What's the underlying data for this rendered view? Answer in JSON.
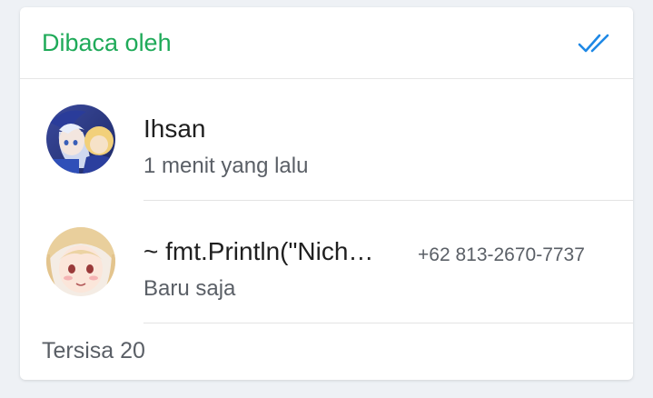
{
  "header": {
    "title": "Dibaca oleh",
    "status_icon": "double-check-icon",
    "title_color": "#1faa59",
    "icon_color": "#1e88e5"
  },
  "readers": [
    {
      "name": "Ihsan",
      "time": "1 menit yang lalu",
      "avatar_icon": "avatar-anime-blue"
    },
    {
      "name": "~ fmt.Println(\"Nich…",
      "phone": "+62 813-2670-7737",
      "time": "Baru saja",
      "avatar_icon": "avatar-anime-blonde"
    }
  ],
  "footer": {
    "remaining": "Tersisa 20"
  }
}
